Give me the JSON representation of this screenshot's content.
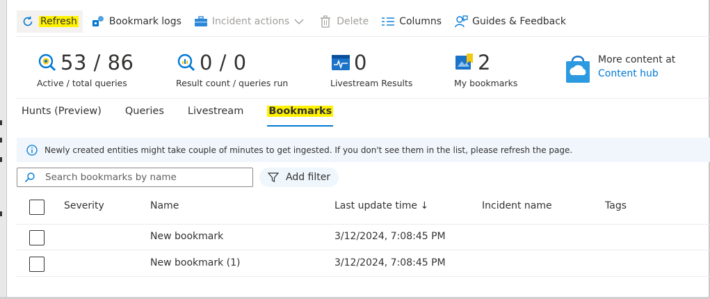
{
  "toolbar": {
    "refresh": "Refresh",
    "bookmark_logs": "Bookmark logs",
    "incident_actions": "Incident actions",
    "delete": "Delete",
    "columns": "Columns",
    "guides": "Guides & Feedback"
  },
  "stats": [
    {
      "value": "53 / 86",
      "label": "Active / total queries",
      "icon": "query-icon"
    },
    {
      "value": "0 / 0",
      "label": "Result count / queries run",
      "icon": "result-query-icon"
    },
    {
      "value": "0",
      "label": "Livestream Results",
      "icon": "livestream-icon"
    },
    {
      "value": "2",
      "label": "My bookmarks",
      "icon": "bookmark-icon"
    }
  ],
  "content_hub": {
    "line1": "More content at",
    "link": "Content hub",
    "icon": "shopping-bag-icon"
  },
  "tabs": [
    "Hunts (Preview)",
    "Queries",
    "Livestream",
    "Bookmarks"
  ],
  "active_tab": "Bookmarks",
  "info_message": "Newly created entities might take couple of minutes to get ingested. If you don't see them in the list, please refresh the page.",
  "search": {
    "placeholder": "Search bookmarks by name"
  },
  "filter": {
    "label": "Add filter"
  },
  "table": {
    "columns": [
      "Severity",
      "Name",
      "Last update time ↓",
      "Incident name",
      "Tags"
    ],
    "rows": [
      {
        "severity": "",
        "name": "New bookmark",
        "updated": "3/12/2024, 7:08:45 PM",
        "incident": "",
        "tags": ""
      },
      {
        "severity": "",
        "name": "New bookmark (1)",
        "updated": "3/12/2024, 7:08:45 PM",
        "incident": "",
        "tags": ""
      }
    ]
  },
  "colors": {
    "accent": "#0078d4",
    "highlight": "#fff200",
    "info_bg": "#f0f6fc"
  }
}
